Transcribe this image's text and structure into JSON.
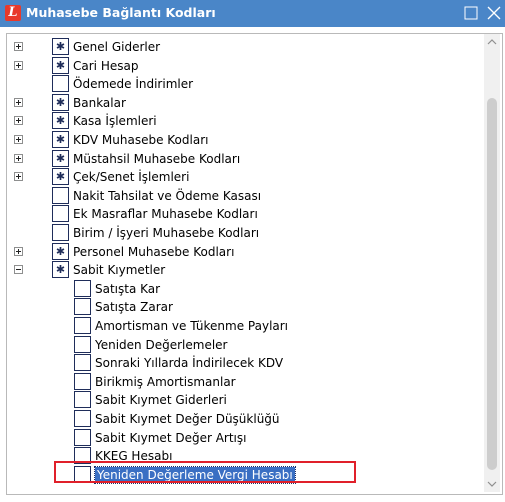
{
  "window": {
    "title": "Muhasebe Bağlantı Kodları",
    "app_icon_letter": "L",
    "close_glyph": "✕"
  },
  "tree": {
    "items": [
      {
        "label": "Genel Giderler",
        "expander": "plus",
        "starred": true,
        "level": 0
      },
      {
        "label": "Cari Hesap",
        "expander": "plus",
        "starred": true,
        "level": 0
      },
      {
        "label": "Ödemede İndirimler",
        "expander": "none",
        "starred": false,
        "level": 0
      },
      {
        "label": "Bankalar",
        "expander": "plus",
        "starred": true,
        "level": 0
      },
      {
        "label": "Kasa İşlemleri",
        "expander": "plus",
        "starred": true,
        "level": 0
      },
      {
        "label": "KDV Muhasebe Kodları",
        "expander": "plus",
        "starred": true,
        "level": 0
      },
      {
        "label": "Müstahsil Muhasebe Kodları",
        "expander": "plus",
        "starred": true,
        "level": 0
      },
      {
        "label": "Çek/Senet İşlemleri",
        "expander": "plus",
        "starred": true,
        "level": 0
      },
      {
        "label": "Nakit Tahsilat ve Ödeme Kasası",
        "expander": "none",
        "starred": false,
        "level": 0
      },
      {
        "label": "Ek Masraflar Muhasebe Kodları",
        "expander": "none",
        "starred": false,
        "level": 0
      },
      {
        "label": "Birim / İşyeri Muhasebe Kodları",
        "expander": "none",
        "starred": false,
        "level": 0
      },
      {
        "label": "Personel Muhasebe Kodları",
        "expander": "plus",
        "starred": true,
        "level": 0
      },
      {
        "label": "Sabit Kıymetler",
        "expander": "minus",
        "starred": true,
        "level": 0
      },
      {
        "label": "Satışta Kar",
        "expander": "none",
        "starred": false,
        "level": 1
      },
      {
        "label": "Satışta Zarar",
        "expander": "none",
        "starred": false,
        "level": 1
      },
      {
        "label": "Amortisman ve Tükenme Payları",
        "expander": "none",
        "starred": false,
        "level": 1
      },
      {
        "label": "Yeniden Değerlemeler",
        "expander": "none",
        "starred": false,
        "level": 1
      },
      {
        "label": "Sonraki Yıllarda İndirilecek KDV",
        "expander": "none",
        "starred": false,
        "level": 1
      },
      {
        "label": "Birikmiş Amortismanlar",
        "expander": "none",
        "starred": false,
        "level": 1
      },
      {
        "label": "Sabit Kıymet Giderleri",
        "expander": "none",
        "starred": false,
        "level": 1
      },
      {
        "label": "Sabit Kıymet Değer Düşüklüğü",
        "expander": "none",
        "starred": false,
        "level": 1
      },
      {
        "label": "Sabit Kıymet Değer Artışı",
        "expander": "none",
        "starred": false,
        "level": 1
      },
      {
        "label": "KKEG Hesabı",
        "expander": "none",
        "starred": false,
        "level": 1
      },
      {
        "label": "Yeniden Değerleme Vergi Hesabı",
        "expander": "none",
        "starred": false,
        "level": 1,
        "selected": true
      }
    ]
  },
  "colors": {
    "titlebar": "#4a86c8",
    "selection": "#3a6fc3",
    "annotation_box": "#e0202a"
  }
}
